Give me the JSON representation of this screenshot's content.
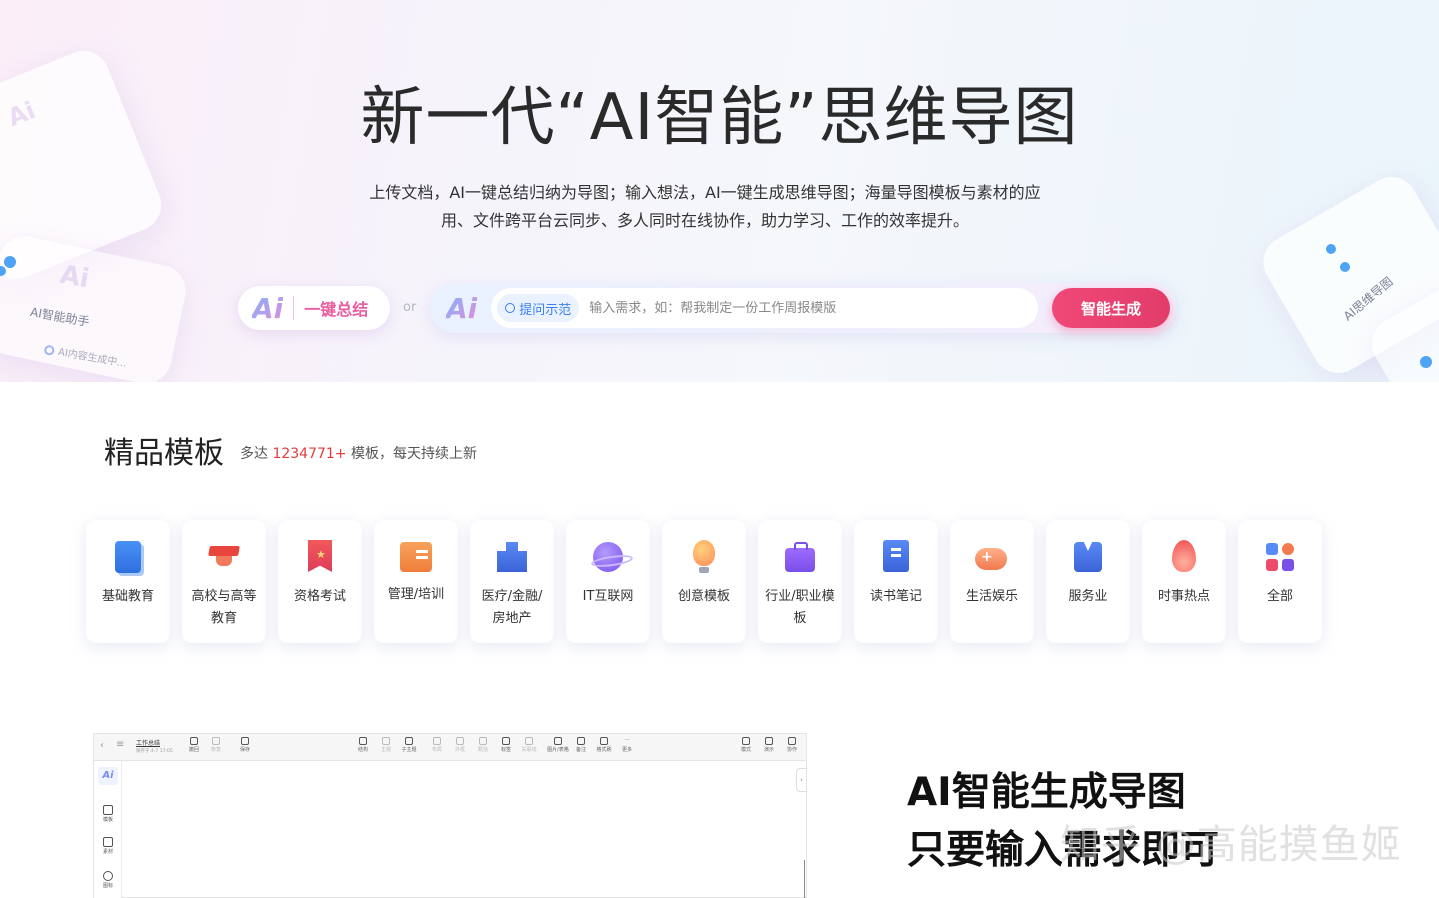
{
  "hero": {
    "title": "新一代“AI智能”思维导图",
    "desc_line1": "上传文档，AI一键总结归纳为导图；输入想法，AI一键生成思维导图；海量导图模板与素材的应",
    "desc_line2": "用、文件跨平台云同步、多人同时在线协作，助力学习、工作的效率提升。",
    "ai_badge": "Ai",
    "summary_label": "一键总结",
    "or_text": "or",
    "demo_chip": "提问示范",
    "input_placeholder": "输入需求，如：帮我制定一份工作周报模版",
    "input_value": "",
    "generate_label": "智能生成",
    "deco_ai_helper": "AI智能助手",
    "deco_ai_generating": "AI内容生成中...",
    "deco_ai_mindmap": "AI思维导图"
  },
  "templates": {
    "title": "精品模板",
    "sub_prefix": "多达",
    "count": "1234771+",
    "sub_suffix": "模板，每天持续上新",
    "categories": [
      {
        "label": "基础教育",
        "icon": "book-icon"
      },
      {
        "label": "高校与高等教育",
        "icon": "graduation-cap-icon"
      },
      {
        "label": "资格考试",
        "icon": "certificate-icon"
      },
      {
        "label": "管理/培训",
        "icon": "management-icon"
      },
      {
        "label": "医疗/金融/房地产",
        "icon": "hospital-icon"
      },
      {
        "label": "IT互联网",
        "icon": "planet-icon"
      },
      {
        "label": "创意模板",
        "icon": "lightbulb-icon"
      },
      {
        "label": "行业/职业模板",
        "icon": "briefcase-icon"
      },
      {
        "label": "读书笔记",
        "icon": "notebook-icon"
      },
      {
        "label": "生活娱乐",
        "icon": "gamepad-icon"
      },
      {
        "label": "服务业",
        "icon": "uniform-icon"
      },
      {
        "label": "时事热点",
        "icon": "flame-icon"
      },
      {
        "label": "全部",
        "icon": "grid-icon"
      }
    ]
  },
  "editor": {
    "doc_title": "工作总结",
    "saved_text": "保存于 4-7 17:05",
    "toolbar_left": [
      "撤回",
      "恢复",
      "保存"
    ],
    "toolbar_mid": [
      "结构",
      "主题",
      "子主题",
      "布局",
      "外框",
      "概括",
      "标签",
      "关联线",
      "图片/表格",
      "备注",
      "格式刷",
      "更多"
    ],
    "toolbar_right": [
      "模式",
      "演示",
      "协作"
    ],
    "side": [
      "模板",
      "素材",
      "图标"
    ]
  },
  "promo": {
    "line1": "AI智能生成导图",
    "line2": "只要输入需求即可"
  },
  "watermark": "知乎 @高能摸鱼姬"
}
